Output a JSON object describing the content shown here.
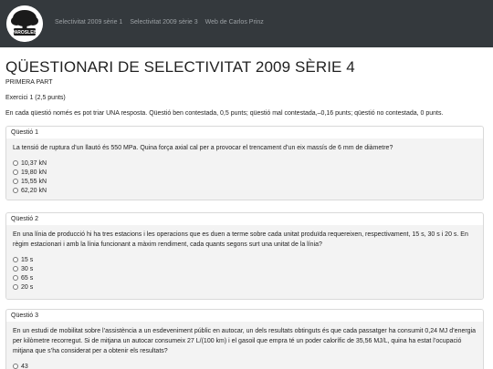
{
  "nav": {
    "logo_text": "PAROSLEIS",
    "links": [
      "Selectivitat 2009 sèrie 1",
      "Selectivitat 2009 sèrie 3",
      "Web de Carlos Prinz"
    ]
  },
  "page": {
    "title": "QÜESTIONARI DE SELECTIVITAT 2009 SÈRIE 4",
    "subtitle": "PRIMERA PART",
    "exercise": "Exercici 1 (2,5 punts)",
    "instructions": "En cada qüestió només es pot triar UNA resposta. Qüestió ben contestada, 0,5 punts; qüestió mal contestada,–0,16 punts; qüestió no contestada, 0 punts."
  },
  "questions": [
    {
      "label": "Qüestió 1",
      "text": "La tensió de ruptura d’un llautó és 550 MPa. Quina força axial cal per a provocar el trencament d’un eix massís de 6 mm de diàmetre?",
      "options": [
        "10,37 kN",
        "19,80 kN",
        "15,55 kN",
        "62,20 kN"
      ]
    },
    {
      "label": "Qüestió 2",
      "text": "En una línia de producció hi ha tres estacions i les operacions que es duen a terme sobre cada unitat produïda requereixen, respectivament, 15 s, 30 s i 20 s. En règim estacionari i amb la línia funcionant a màxim rendiment, cada quants segons surt una unitat de la línia?",
      "options": [
        "15 s",
        "30 s",
        "65 s",
        "20 s"
      ]
    },
    {
      "label": "Qüestió 3",
      "text": "En un estudi de mobilitat sobre l’assistència a un esdeveniment públic en autocar, un dels resultats obtinguts és que cada passatger ha consumit 0,24 MJ d’energia per kilòmetre recorregut. Si de mitjana un autocar consumeix 27 L/(100 km) i el gasoil que empra té un poder calorífic de 35,56 MJ/L, quina ha estat l’ocupació mitjana que s’ha considerat per a obtenir els resultats?",
      "options": [
        "43"
      ]
    }
  ]
}
